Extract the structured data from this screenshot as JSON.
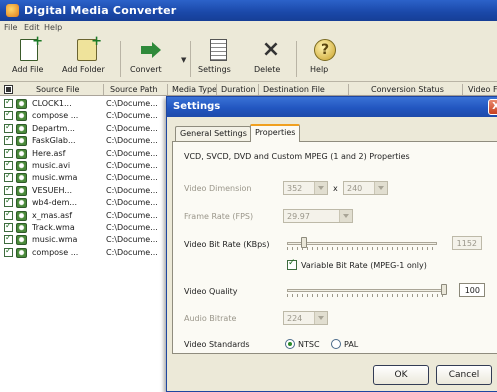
{
  "window": {
    "title": "Digital Media Converter",
    "menu": [
      "File",
      "Edit",
      "Help"
    ]
  },
  "toolbar": {
    "add_file": "Add File",
    "add_folder": "Add Folder",
    "convert": "Convert",
    "settings": "Settings",
    "delete": "Delete",
    "help": "Help"
  },
  "list": {
    "columns": [
      "Source File",
      "Source Path",
      "Media Type",
      "Duration",
      "Destination File",
      "Conversion Status",
      "Video F"
    ],
    "rows": [
      {
        "file": "CLOCK1...",
        "path": "C:\\Docume..."
      },
      {
        "file": "compose ...",
        "path": "C:\\Docume..."
      },
      {
        "file": "Departm...",
        "path": "C:\\Docume..."
      },
      {
        "file": "FaskGlab...",
        "path": "C:\\Docume..."
      },
      {
        "file": "Here.asf",
        "path": "C:\\Docume..."
      },
      {
        "file": "music.avi",
        "path": "C:\\Docume..."
      },
      {
        "file": "music.wma",
        "path": "C:\\Docume..."
      },
      {
        "file": "VESUEH...",
        "path": "C:\\Docume..."
      },
      {
        "file": "wb4-dem...",
        "path": "C:\\Docume..."
      },
      {
        "file": "x_mas.asf",
        "path": "C:\\Docume..."
      },
      {
        "file": "Track.wma",
        "path": "C:\\Docume..."
      },
      {
        "file": "music.wma",
        "path": "C:\\Docume..."
      },
      {
        "file": "compose ...",
        "path": "C:\\Docume..."
      }
    ]
  },
  "dialog": {
    "title": "Settings",
    "close": "X",
    "tabs": [
      "General Settings",
      "Properties"
    ],
    "active_tab": "Properties",
    "heading": "VCD, SVCD, DVD and Custom MPEG (1 and 2) Properties",
    "video_dimension": {
      "label": "Video Dimension",
      "width": "352",
      "x": "x",
      "height": "240"
    },
    "frame_rate": {
      "label": "Frame Rate (FPS)",
      "value": "29.97"
    },
    "video_bit_rate": {
      "label": "Video Bit Rate (KBps)",
      "value": "1152",
      "fraction": 0.1
    },
    "variable_bit_rate": {
      "label": "Variable Bit Rate (MPEG-1 only)",
      "checked": true
    },
    "video_quality": {
      "label": "Video Quality",
      "value": "100",
      "fraction": 1.0
    },
    "audio_bitrate": {
      "label": "Audio Bitrate",
      "value": "224"
    },
    "video_standards": {
      "label": "Video Standards",
      "ntsc": "NTSC",
      "pal": "PAL",
      "selected": "NTSC"
    },
    "ok": "OK",
    "cancel": "Cancel"
  }
}
